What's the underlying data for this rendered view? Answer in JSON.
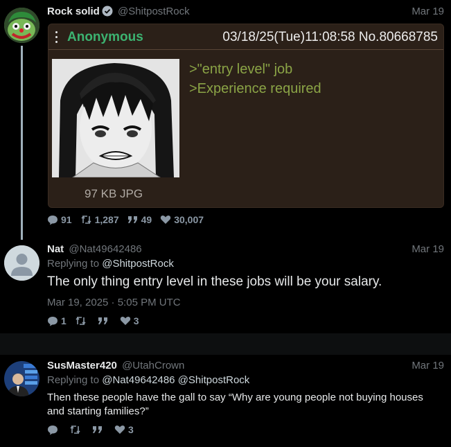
{
  "tweets": [
    {
      "name": "Rock solid",
      "handle": "@ShitpostRock",
      "date": "Mar 19",
      "verified": true,
      "post": {
        "poster": "Anonymous",
        "meta": "03/18/25(Tue)11:08:58 No.80668785",
        "file": "97 KB JPG",
        "lines": [
          ">\"entry level\" job",
          ">Experience required"
        ]
      },
      "stats": {
        "replies": "91",
        "retweets": "1,287",
        "quotes": "49",
        "likes": "30,007"
      }
    },
    {
      "name": "Nat",
      "handle": "@Nat49642486",
      "date": "Mar 19",
      "replying_label": "Replying to",
      "replying_to": "@ShitpostRock",
      "text": "The only thing entry level in these jobs will be your salary.",
      "timestamp": "Mar 19, 2025 · 5:05 PM UTC",
      "stats": {
        "replies": "1",
        "retweets": "",
        "quotes": "",
        "likes": "3"
      }
    },
    {
      "name": "SusMaster420",
      "handle": "@UtahCrown",
      "date": "Mar 19",
      "replying_label": "Replying to",
      "replying_to": "@Nat49642486 @ShitpostRock",
      "text": "Then these people have the gall to say “Why are young people not buying houses and starting families?”",
      "stats": {
        "replies": "",
        "retweets": "",
        "quotes": "",
        "likes": "3"
      }
    }
  ],
  "icons": [
    "comment-icon",
    "retweet-icon",
    "quote-icon",
    "heart-icon",
    "verified-icon",
    "kebab-icon"
  ],
  "colors": {
    "greentext": "#8ba446",
    "poster_name": "#3cb371",
    "card_bg": "#2b2018",
    "muted": "#71767b"
  }
}
